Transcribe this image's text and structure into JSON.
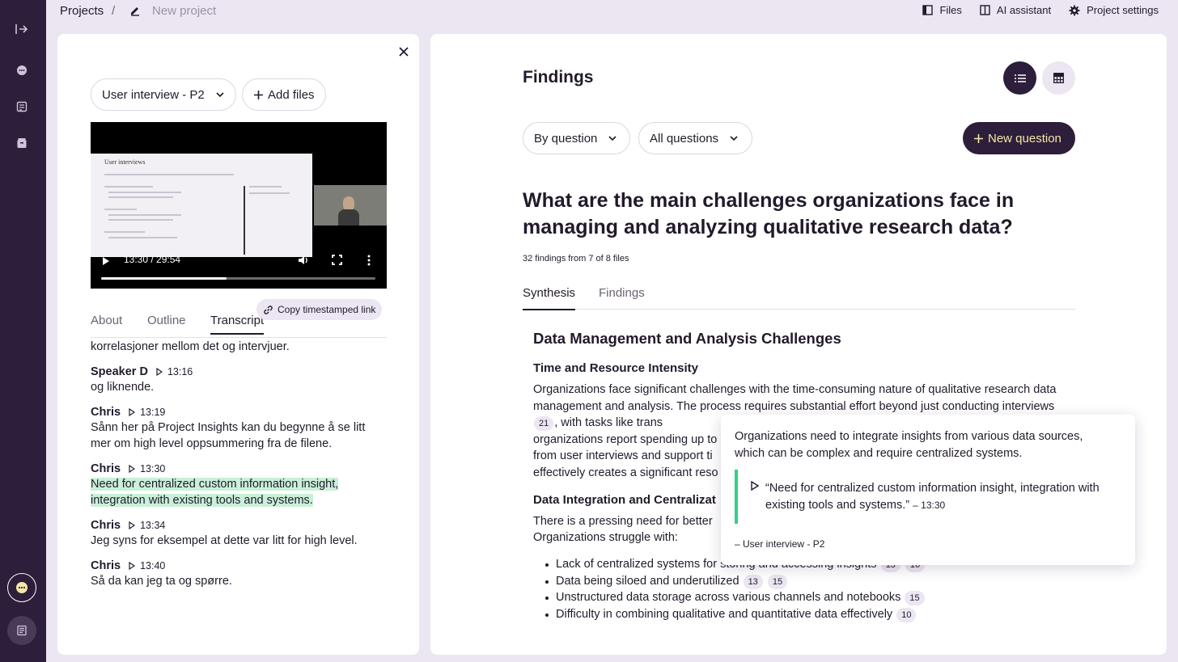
{
  "breadcrumb": {
    "root": "Projects",
    "separator": "/",
    "current": "New project"
  },
  "top_actions": {
    "files": "Files",
    "ai": "AI assistant",
    "settings": "Project settings"
  },
  "left_panel": {
    "file_select": "User interview - P2",
    "add_files": "Add files",
    "video": {
      "screen_title": "User interviews",
      "time": "13:30 / 29:54",
      "progress": 0.456
    },
    "tabs": [
      "About",
      "Outline",
      "Transcript"
    ],
    "copy_link": "Copy timestamped link",
    "transcript": {
      "lead_text": "korrelasjoner mellom det og intervjuer.",
      "entries": [
        {
          "speaker": "Speaker D",
          "time": "13:16",
          "text": "og liknende."
        },
        {
          "speaker": "Chris",
          "time": "13:19",
          "text": "Sånn her på Project Insights kan du begynne å se litt mer om high level oppsummering fra de filene."
        },
        {
          "speaker": "Chris",
          "time": "13:30",
          "text": "Need for centralized custom information insight, integration with existing tools and systems."
        },
        {
          "speaker": "Chris",
          "time": "13:34",
          "text": "Jeg syns for eksempel at dette var litt for high level."
        },
        {
          "speaker": "Chris",
          "time": "13:40",
          "text": "Så da kan jeg ta og spørre."
        }
      ]
    }
  },
  "right_panel": {
    "title": "Findings",
    "filters": {
      "group": "By question",
      "questions": "All questions"
    },
    "new_question": "New question",
    "question": "What are the main challenges organizations face in managing and analyzing qualitative research data?",
    "meta": "32 findings from 7 of 8 files",
    "tabs": [
      "Synthesis",
      "Findings"
    ],
    "synthesis": {
      "h2": "Data Management and Analysis Challenges",
      "s1_title": "Time and Resource Intensity",
      "s1_a": "Organizations face significant challenges with the time-consuming nature of qualitative research data management and analysis. The process requires substantial effort beyond just conducting interviews",
      "s1_cite": "21",
      "s1_b": ", with tasks like trans",
      "s1_c": "organizations report spending up to",
      "s1_d": "from user interviews and support ti",
      "s1_e": "effectively creates a significant reso",
      "s2_title": "Data Integration and Centralizat",
      "s2_a": "There is a pressing need for better",
      "s2_b": "Organizations struggle with:",
      "bullets": [
        {
          "text": "Lack of centralized systems for storing and accessing insights",
          "cites": [
            "13",
            "16"
          ]
        },
        {
          "text": "Data being siloed and underutilized",
          "cites": [
            "13",
            "15"
          ]
        },
        {
          "text": "Unstructured data storage across various channels and notebooks",
          "cites": [
            "15"
          ]
        },
        {
          "text": "Difficulty in combining qualitative and quantitative data effectively",
          "cites": [
            "10"
          ]
        }
      ]
    }
  },
  "popover": {
    "text": "Organizations need to integrate insights from various data sources, which can be complex and require centralized systems.",
    "quote": "“Need for centralized custom information insight, integration with existing tools and systems.”",
    "quote_time": "– 13:30",
    "source": "– User interview - P2"
  },
  "colors": {
    "rail": "#2d1e3b",
    "background": "#ebe6f1",
    "highlight": "#c9f0d8",
    "accent_bar": "#2fd184",
    "button_text": "#f5e7a6"
  }
}
